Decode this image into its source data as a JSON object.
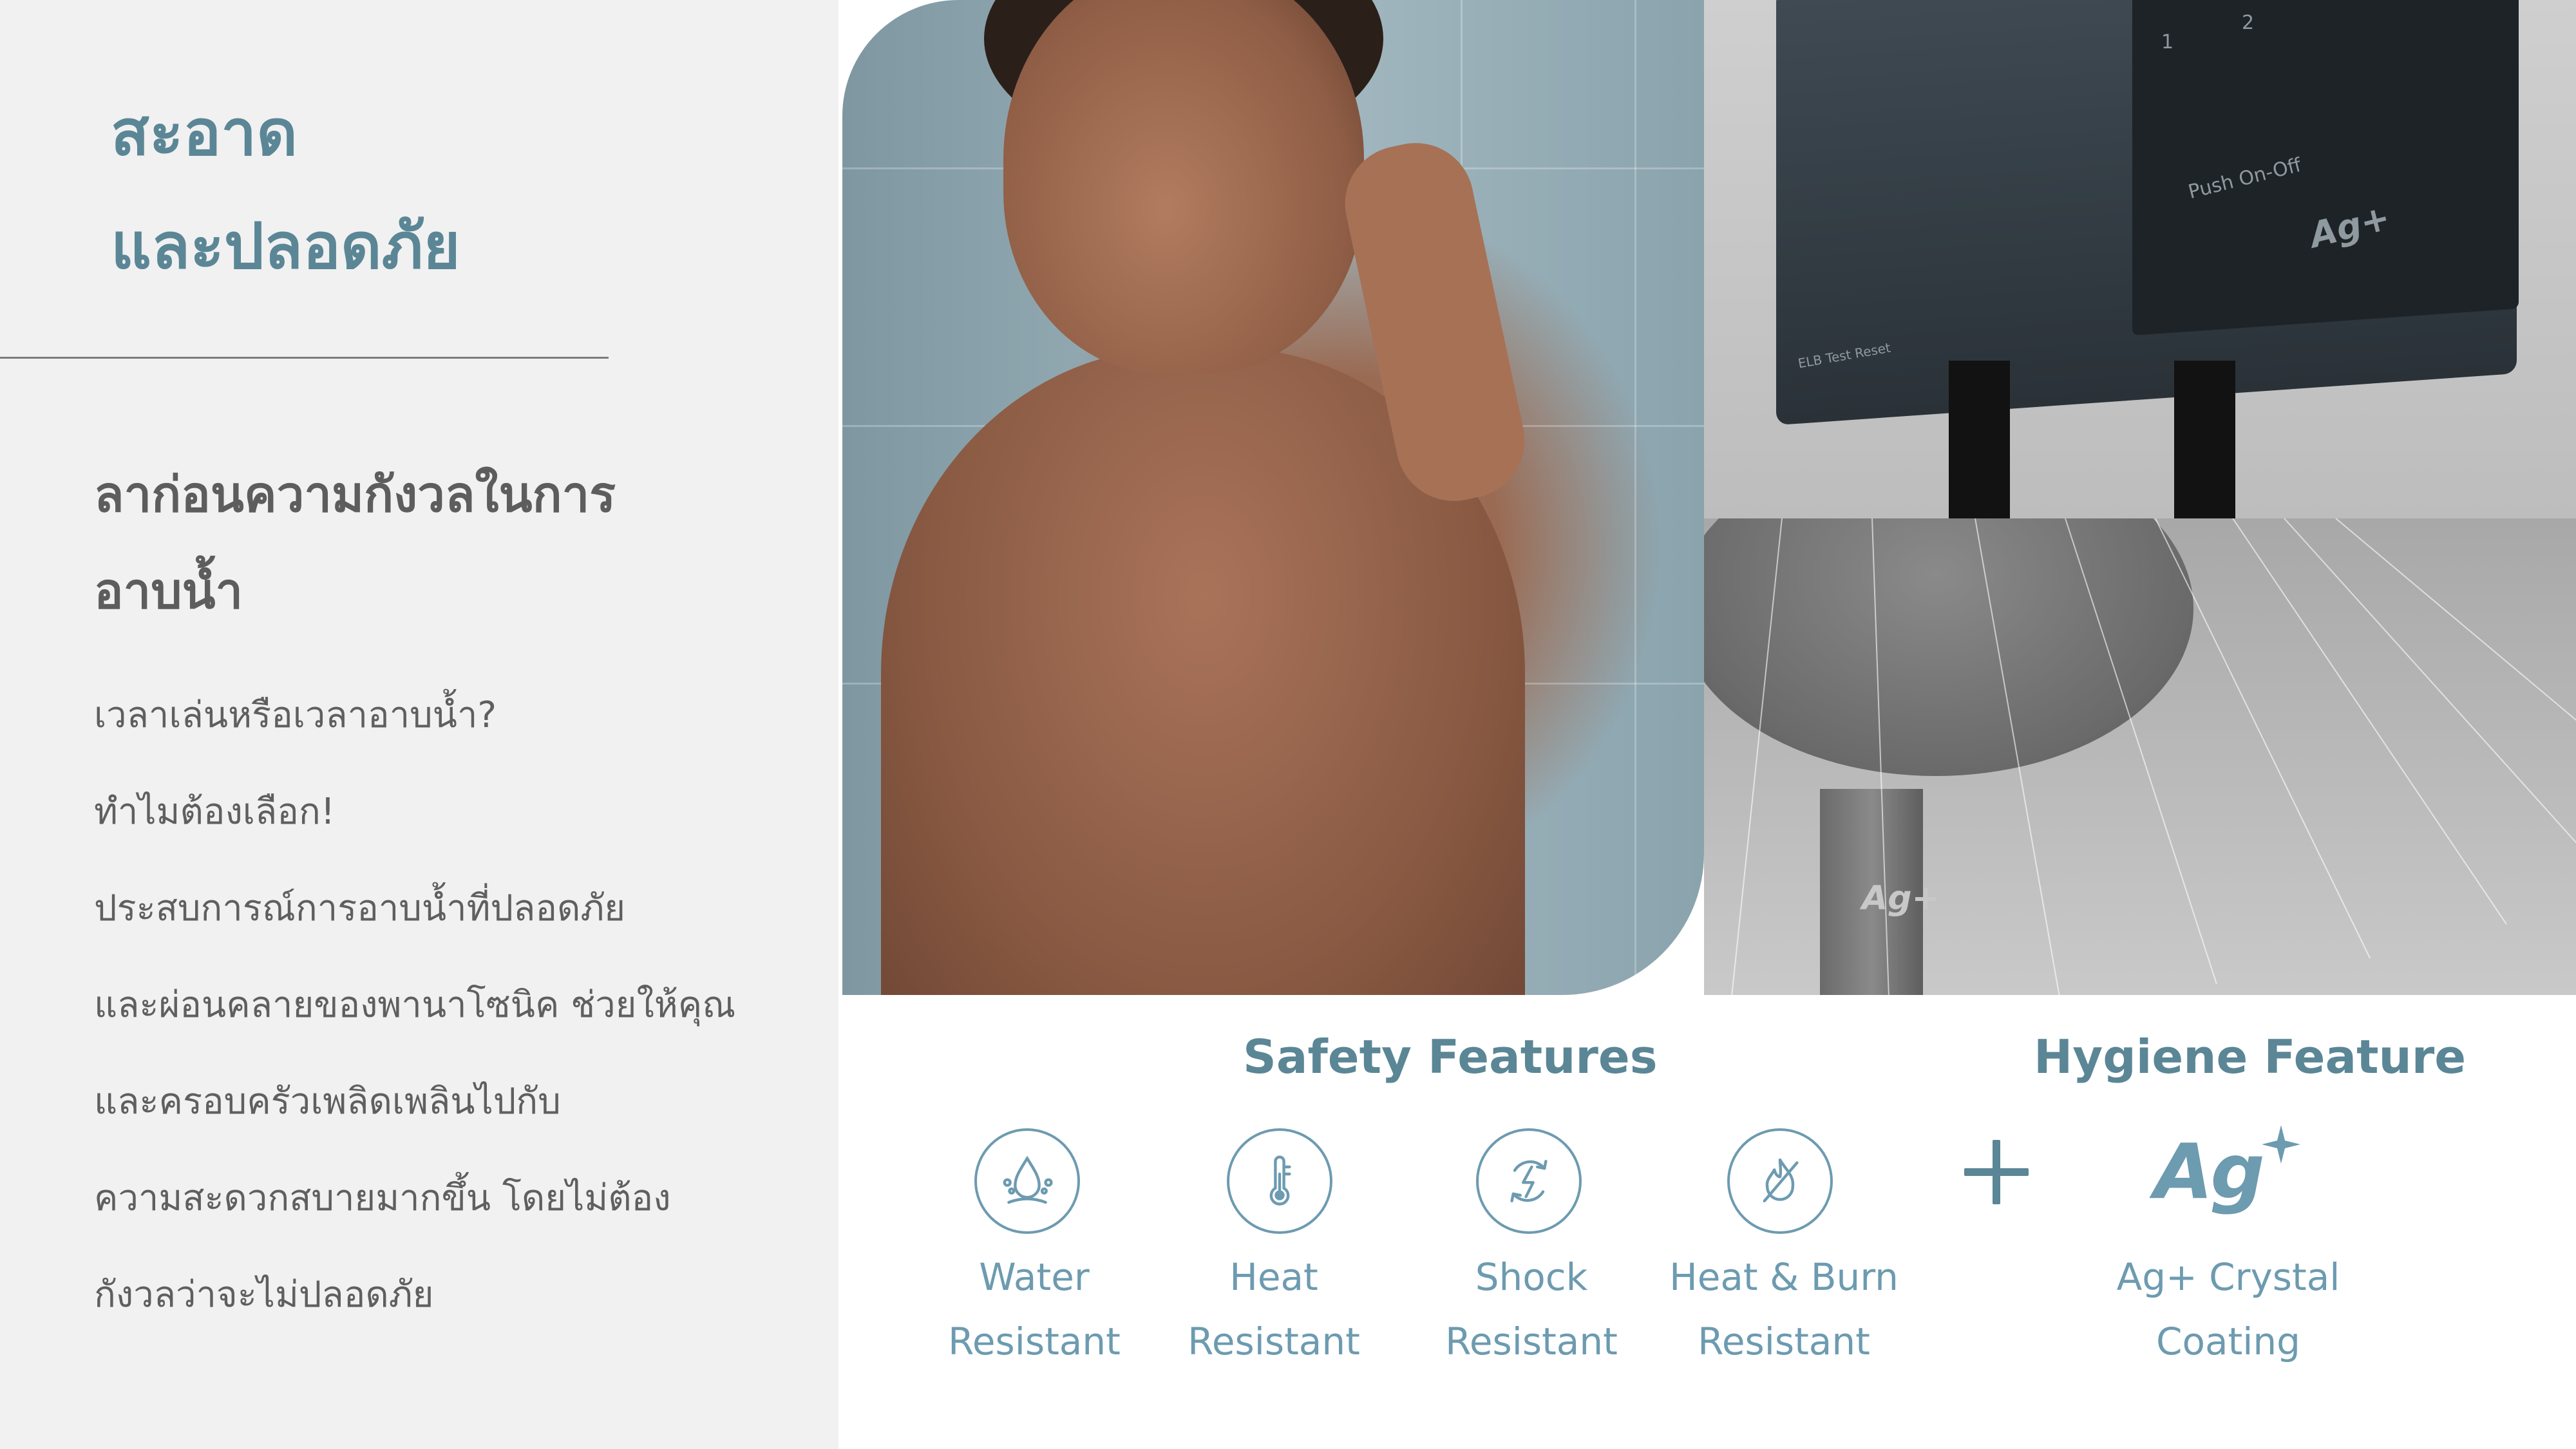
{
  "headline": {
    "line1": "สะอาด",
    "line2": "และปลอดภัย"
  },
  "subheading": {
    "line1": "ลาก่อนความกังวลในการ",
    "line2": "อาบน้ำ"
  },
  "body_lines": [
    "เวลาเล่นหรือเวลาอาบน้ำ?",
    "ทำไมต้องเลือก!",
    "ประสบการณ์การอาบน้ำที่ปลอดภัย",
    "และผ่อนคลายของพานาโซนิค ช่วยให้คุณ",
    "และครอบครัวเพลิดเพลินไปกับ",
    "ความสะดวกสบายมากขึ้น โดยไม่ต้อง",
    "กังวลว่าจะไม่ปลอดภัย"
  ],
  "photos": {
    "boy": "boy-showering-photo",
    "heater": {
      "button1": "1",
      "button2": "2",
      "push_label": "Push On-Off",
      "elb_label": "ELB Test Reset",
      "logo": "Ag+"
    },
    "shower": {
      "logo": "Ag+"
    }
  },
  "sections": {
    "safety_title": "Safety Features",
    "hygiene_title": "Hygiene Feature"
  },
  "features": [
    {
      "icon": "water-drop-icon",
      "line1": "Water",
      "line2": "Resistant"
    },
    {
      "icon": "thermometer-icon",
      "line1": "Heat",
      "line2": "Resistant"
    },
    {
      "icon": "lightning-icon",
      "line1": "Shock",
      "line2": "Resistant"
    },
    {
      "icon": "no-flame-icon",
      "line1": "Heat & Burn",
      "line2": "Resistant"
    }
  ],
  "hygiene": {
    "logo": "Ag",
    "line1": "Ag+ Crystal",
    "line2": "Coating"
  },
  "colors": {
    "accent": "#5b8696",
    "icon": "#6d9bb0",
    "panel_bg": "#f1f1f1",
    "body_text": "#5f5f5f"
  }
}
